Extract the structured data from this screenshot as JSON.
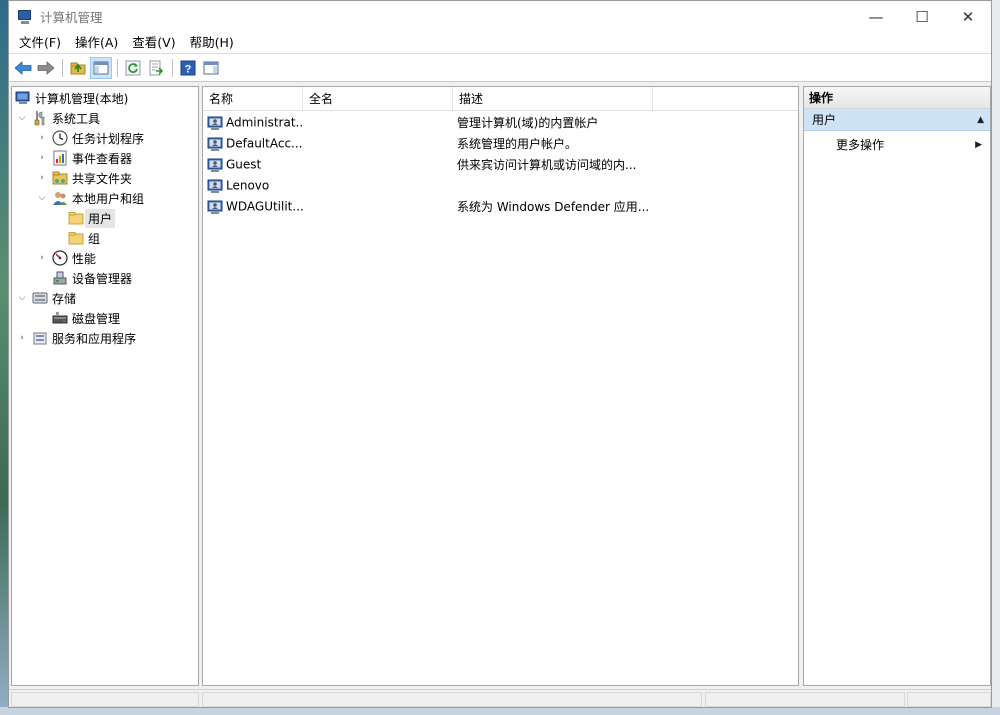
{
  "window": {
    "title": "计算机管理",
    "controls": {
      "minimize": "—",
      "maximize": "☐",
      "close": "✕"
    }
  },
  "menu": [
    "文件(F)",
    "操作(A)",
    "查看(V)",
    "帮助(H)"
  ],
  "toolbar": {
    "icons": [
      "back-arrow-icon",
      "forward-arrow-icon",
      "up-folder-icon",
      "show-tree-icon",
      "refresh-icon",
      "export-list-icon",
      "help-icon",
      "show-action-pane-icon"
    ]
  },
  "tree": {
    "root": "计算机管理(本地)",
    "system_tools": "系统工具",
    "task_scheduler": "任务计划程序",
    "event_viewer": "事件查看器",
    "shared_folders": "共享文件夹",
    "local_users_groups": "本地用户和组",
    "users": "用户",
    "groups": "组",
    "performance": "性能",
    "device_manager": "设备管理器",
    "storage": "存储",
    "disk_management": "磁盘管理",
    "services_apps": "服务和应用程序"
  },
  "list": {
    "columns": [
      "名称",
      "全名",
      "描述"
    ],
    "rows": [
      {
        "name": "Administrat...",
        "fullname": "",
        "desc": "管理计算机(域)的内置帐户"
      },
      {
        "name": "DefaultAcc...",
        "fullname": "",
        "desc": "系统管理的用户帐户。"
      },
      {
        "name": "Guest",
        "fullname": "",
        "desc": "供来宾访问计算机或访问域的内..."
      },
      {
        "name": "Lenovo",
        "fullname": "",
        "desc": ""
      },
      {
        "name": "WDAGUtilit...",
        "fullname": "",
        "desc": "系统为 Windows Defender 应用..."
      }
    ]
  },
  "actions": {
    "title": "操作",
    "section": "用户",
    "more": "更多操作"
  },
  "colors": {
    "selection": "#e5e5e5",
    "action_section_bg": "#cfe3f7",
    "window_bg": "#f0f0f0"
  }
}
